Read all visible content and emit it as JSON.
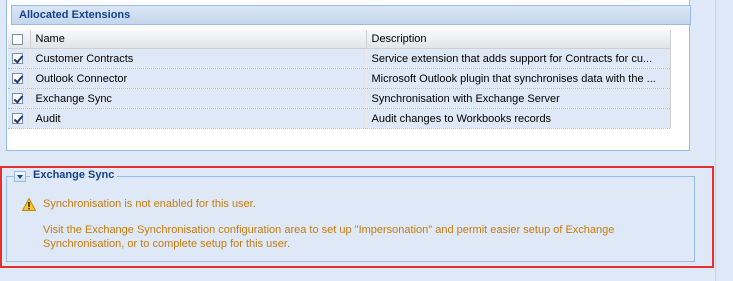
{
  "allocated_panel": {
    "title": "Allocated Extensions",
    "columns": {
      "name": "Name",
      "description": "Description"
    },
    "rows": [
      {
        "checked": true,
        "name": "Customer Contracts",
        "description": "Service extension that adds support for Contracts for cu..."
      },
      {
        "checked": true,
        "name": "Outlook Connector",
        "description": "Microsoft Outlook plugin that synchronises data with the ..."
      },
      {
        "checked": true,
        "name": "Exchange Sync",
        "description": "Synchronisation with Exchange Server"
      },
      {
        "checked": true,
        "name": "Audit",
        "description": "Audit changes to Workbooks records"
      }
    ]
  },
  "exchange_panel": {
    "title": "Exchange Sync",
    "icon": "warning-icon",
    "warning": "Synchronisation is not enabled for this user.",
    "instructions": "Visit the Exchange Synchronisation configuration area to set up \"Impersonation\" and permit easier setup of Exchange Synchronisation, or to complete setup for this user.",
    "text_color": "#c47c0b"
  },
  "highlight_color": "#e53030"
}
